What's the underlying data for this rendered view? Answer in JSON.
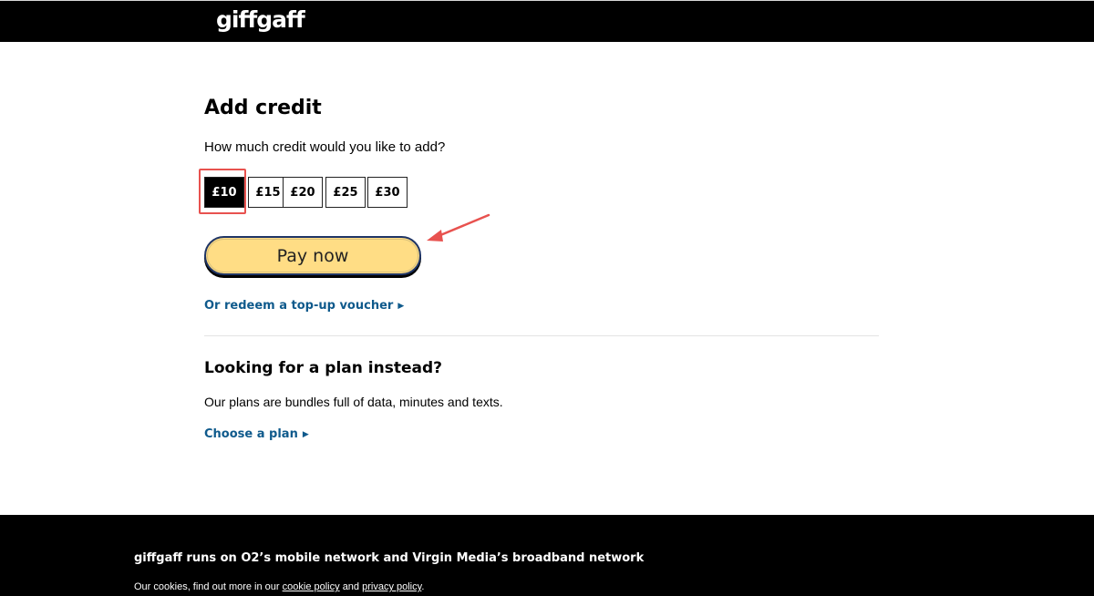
{
  "header": {
    "logo": "giffgaff"
  },
  "main": {
    "title": "Add credit",
    "question": "How much credit would you like to add?",
    "amounts": [
      {
        "label": "£10",
        "selected": true
      },
      {
        "label": "£15",
        "selected": false
      },
      {
        "label": "£20",
        "selected": false
      },
      {
        "label": "£25",
        "selected": false
      },
      {
        "label": "£30",
        "selected": false
      }
    ],
    "pay_button": "Pay now",
    "voucher_link": "Or redeem a top-up voucher",
    "plan_title": "Looking for a plan instead?",
    "plan_description": "Our plans are bundles full of data, minutes and texts.",
    "plan_link": "Choose a plan"
  },
  "footer": {
    "title": "giffgaff runs on O2’s mobile network and Virgin Media’s broadband network",
    "cookies_prefix": "Our cookies, find out more in our",
    "cookie_policy_link": "cookie policy",
    "and_text": "and",
    "privacy_policy_link": "privacy policy",
    "period": "."
  },
  "colors": {
    "header_bg": "#000000",
    "pay_button_bg": "#ffdd85",
    "link_color": "#0f5a8c",
    "annotation_red": "#e8524f"
  },
  "icons": {
    "link_chevron": "chevron-right-icon",
    "annotation_arrow": "arrow-icon"
  }
}
